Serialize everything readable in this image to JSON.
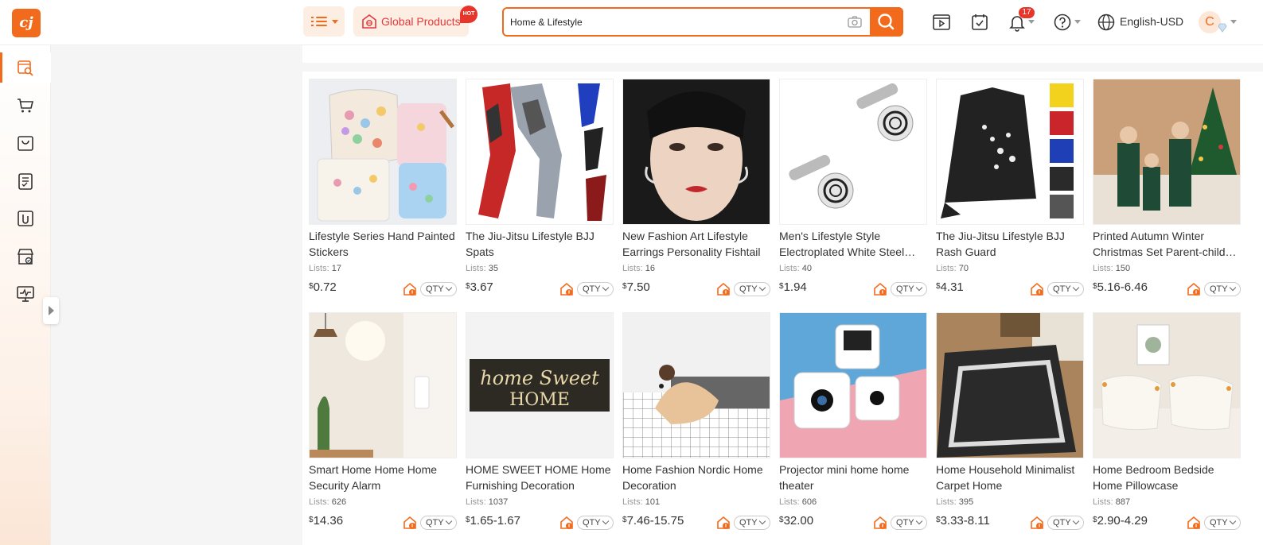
{
  "header": {
    "logo": "cj",
    "global_products_label": "Global Products",
    "hot_badge": "HOT",
    "search": {
      "value": "Home & Lifestyle",
      "placeholder": ""
    },
    "notification_count": "17",
    "language": "English-USD",
    "avatar_initial": "C"
  },
  "sidebar": {
    "items": [
      {
        "icon": "product-search-icon",
        "active": true
      },
      {
        "icon": "cart-icon"
      },
      {
        "icon": "shopping-bag-icon"
      },
      {
        "icon": "order-list-icon"
      },
      {
        "icon": "sourcing-icon"
      },
      {
        "icon": "store-icon"
      },
      {
        "icon": "analytics-monitor-icon"
      }
    ]
  },
  "products": [
    {
      "title": "Lifestyle Series Hand Painted Stickers",
      "lists_label": "Lists:",
      "lists": "17",
      "currency": "$",
      "price": "0.72",
      "qty": "QTY",
      "image": "stickers"
    },
    {
      "title": "The Jiu-Jitsu Lifestyle BJJ Spats",
      "lists_label": "Lists:",
      "lists": "35",
      "currency": "$",
      "price": "3.67",
      "qty": "QTY",
      "image": "spats"
    },
    {
      "title": "New Fashion Art Lifestyle Earrings Personality Fishtail",
      "lists_label": "Lists:",
      "lists": "16",
      "currency": "$",
      "price": "7.50",
      "qty": "QTY",
      "image": "earrings"
    },
    {
      "title": "Men's Lifestyle Style Electroplated White Steel…",
      "lists_label": "Lists:",
      "lists": "40",
      "currency": "$",
      "price": "1.94",
      "qty": "QTY",
      "image": "cufflinks"
    },
    {
      "title": "The Jiu-Jitsu Lifestyle BJJ Rash Guard",
      "lists_label": "Lists:",
      "lists": "70",
      "currency": "$",
      "price": "4.31",
      "qty": "QTY",
      "image": "rashguard"
    },
    {
      "title": "Printed Autumn Winter Christmas Set Parent-child…",
      "lists_label": "Lists:",
      "lists": "150",
      "currency": "$",
      "price": "5.16-6.46",
      "qty": "QTY",
      "image": "christmas"
    },
    {
      "title": "Smart Home Home Home Security Alarm",
      "lists_label": "Lists:",
      "lists": "626",
      "currency": "$",
      "price": "14.36",
      "qty": "QTY",
      "image": "alarm"
    },
    {
      "title": "HOME SWEET HOME Home Furnishing Decoration",
      "lists_label": "Lists:",
      "lists": "1037",
      "currency": "$",
      "price": "1.65-1.67",
      "qty": "QTY",
      "image": "sign",
      "image_text_1": "home Sweet",
      "image_text_2": "HOME"
    },
    {
      "title": "Home Fashion Nordic Home Decoration",
      "lists_label": "Lists:",
      "lists": "101",
      "currency": "$",
      "price": "7.46-15.75",
      "qty": "QTY",
      "image": "mouse"
    },
    {
      "title": "Projector mini home home theater",
      "lists_label": "Lists:",
      "lists": "606",
      "currency": "$",
      "price": "32.00",
      "qty": "QTY",
      "image": "projector"
    },
    {
      "title": "Home Household Minimalist Carpet Home",
      "lists_label": "Lists:",
      "lists": "395",
      "currency": "$",
      "price": "3.33-8.11",
      "qty": "QTY",
      "image": "carpet"
    },
    {
      "title": "Home Bedroom Bedside Home Pillowcase",
      "lists_label": "Lists:",
      "lists": "887",
      "currency": "$",
      "price": "2.90-4.29",
      "qty": "QTY",
      "image": "pillows"
    }
  ],
  "colors": {
    "accent": "#f26b1d",
    "badge": "#e8352b"
  }
}
